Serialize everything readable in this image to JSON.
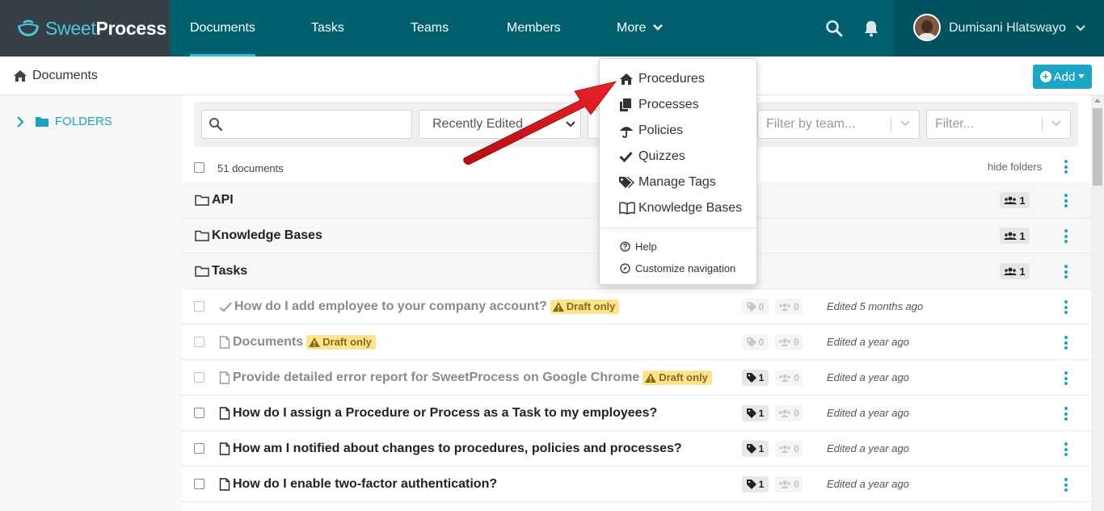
{
  "brand": {
    "part1": "Sweet",
    "part2": "Process"
  },
  "nav": {
    "documents": "Documents",
    "tasks": "Tasks",
    "teams": "Teams",
    "members": "Members",
    "more": "More"
  },
  "user": {
    "name": "Dumisani Hlatswayo"
  },
  "breadcrumb": {
    "title": "Documents"
  },
  "add_button": {
    "label": "Add"
  },
  "sidebar": {
    "folders_label": "FOLDERS"
  },
  "filters": {
    "search_placeholder": "",
    "sort_value": "Recently Edited",
    "team_placeholder": "Filter by team...",
    "filter_placeholder": "Filter..."
  },
  "list": {
    "count": "51 documents",
    "hide_folders": "hide folders"
  },
  "folders": [
    {
      "name": "API",
      "members": "1"
    },
    {
      "name": "Knowledge Bases",
      "members": "1"
    },
    {
      "name": "Tasks",
      "members": "1"
    }
  ],
  "documents": [
    {
      "title": "How do I add employee to your company account?",
      "draft_label": "Draft only",
      "tags": "0",
      "members": "0",
      "edited": "Edited 5 months ago"
    },
    {
      "title": "Documents",
      "draft_label": "Draft only",
      "tags": "0",
      "members": "0",
      "edited": "Edited a year ago"
    },
    {
      "title": "Provide detailed error report for SweetProcess on Google Chrome",
      "draft_label": "Draft only",
      "tags": "1",
      "members": "0",
      "edited": "Edited a year ago"
    },
    {
      "title": "How do I assign a Procedure or Process as a Task to my employees?",
      "tags": "1",
      "members": "0",
      "edited": "Edited a year ago"
    },
    {
      "title": "How am I notified about changes to procedures, policies and processes?",
      "tags": "1",
      "members": "0",
      "edited": "Edited a year ago"
    },
    {
      "title": "How do I enable two-factor authentication?",
      "tags": "1",
      "members": "0",
      "edited": "Edited a year ago"
    }
  ],
  "more_menu": {
    "procedures": "Procedures",
    "processes": "Processes",
    "policies": "Policies",
    "quizzes": "Quizzes",
    "manage_tags": "Manage Tags",
    "knowledge_bases": "Knowledge Bases",
    "help": "Help",
    "customize_navigation": "Customize navigation"
  },
  "colors": {
    "nav_bg": "#00606e",
    "brand_bg": "#354046",
    "accent": "#1aa3c0",
    "draft_badge": "#fde293",
    "annotation_arrow": "#d8141a"
  }
}
